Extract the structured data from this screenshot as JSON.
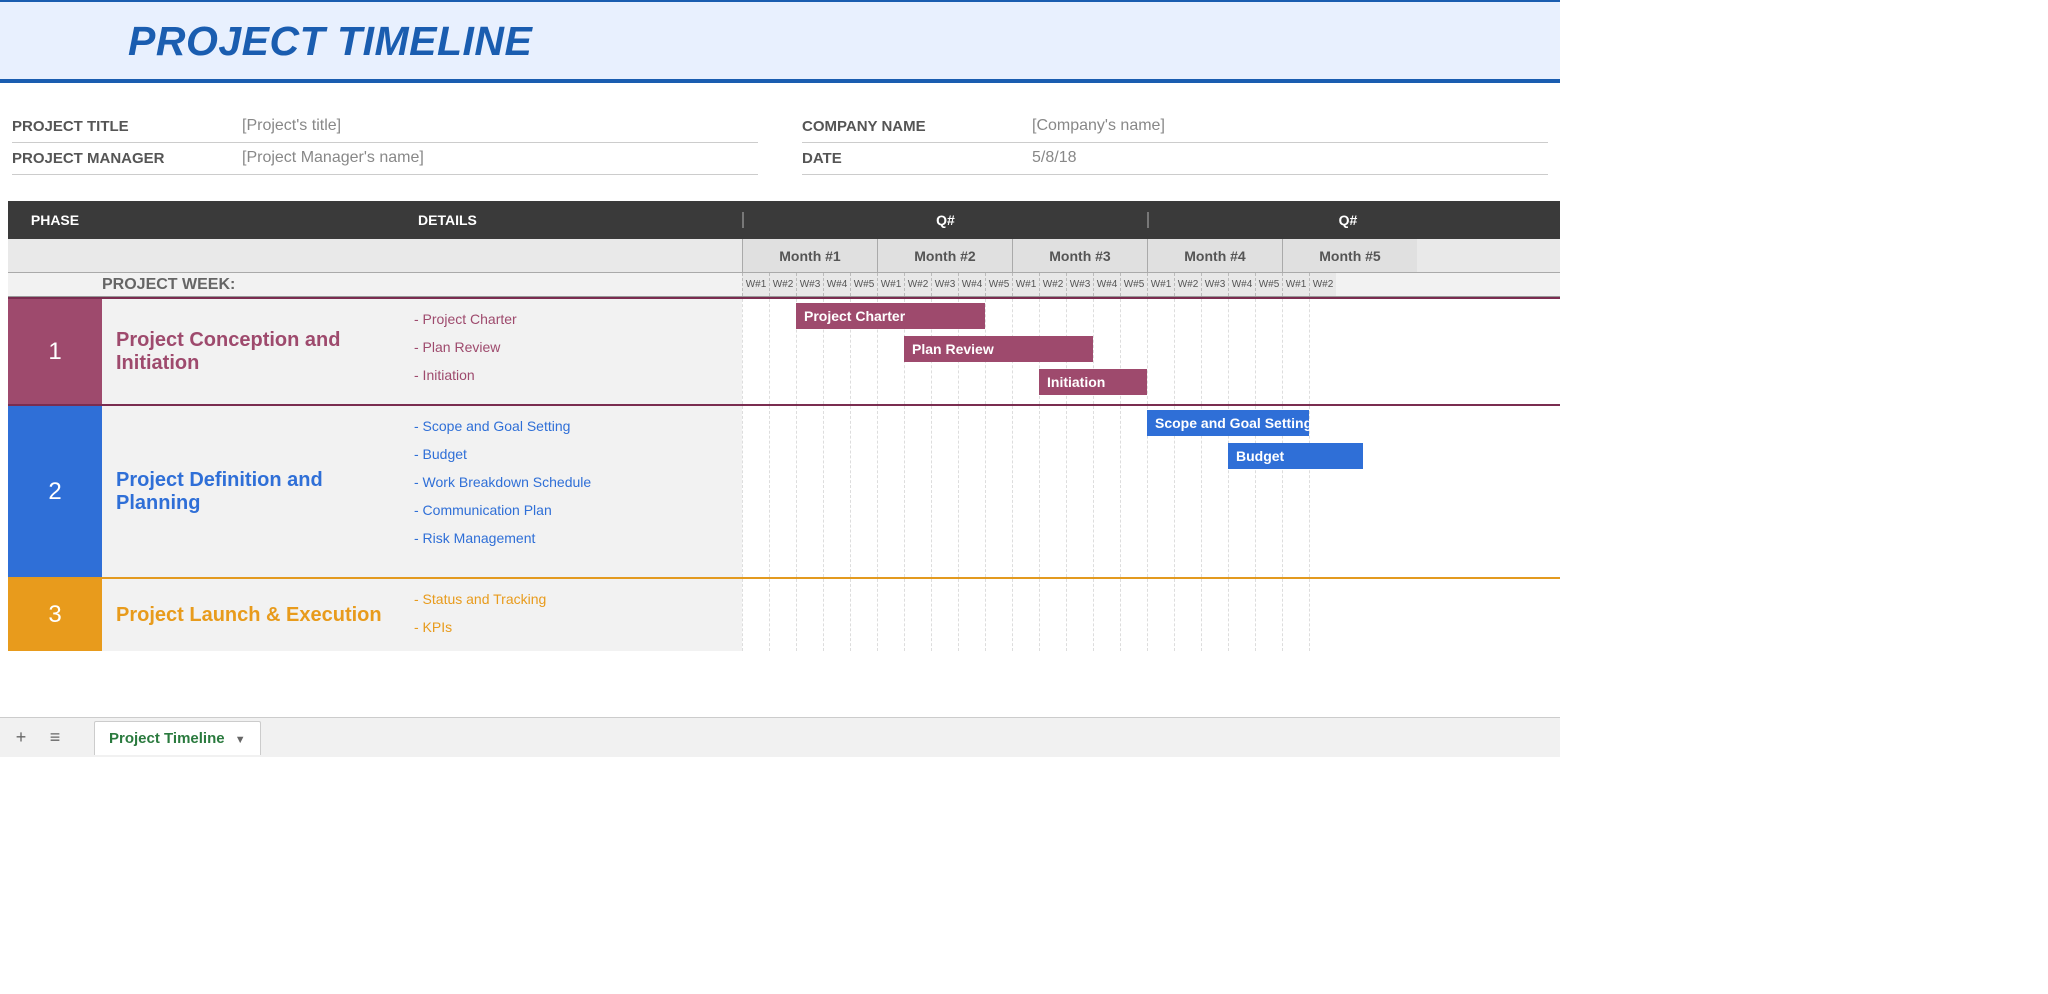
{
  "title": "PROJECT TIMELINE",
  "meta": {
    "left": [
      {
        "label": "PROJECT TITLE",
        "value": "[Project's title]"
      },
      {
        "label": "PROJECT MANAGER",
        "value": "[Project Manager's name]"
      }
    ],
    "right": [
      {
        "label": "COMPANY NAME",
        "value": "[Company's name]"
      },
      {
        "label": "DATE",
        "value": "5/8/18"
      }
    ]
  },
  "headers": {
    "phase": "PHASE",
    "details": "DETAILS",
    "quarters": [
      "Q#",
      "Q#"
    ],
    "months": [
      "Month #1",
      "Month #2",
      "Month #3",
      "Month #4",
      "Month #5"
    ],
    "weeks": [
      "W#1",
      "W#2",
      "W#3",
      "W#4",
      "W#5",
      "W#1",
      "W#2",
      "W#3",
      "W#4",
      "W#5",
      "W#1",
      "W#2",
      "W#3",
      "W#4",
      "W#5",
      "W#1",
      "W#2",
      "W#3",
      "W#4",
      "W#5",
      "W#1",
      "W#2"
    ],
    "project_week": "PROJECT WEEK:"
  },
  "phases": [
    {
      "num": "1",
      "title": "Project Conception and Initiation",
      "details": [
        "- Project Charter",
        "- Plan Review",
        "- Initiation"
      ],
      "bars": [
        {
          "label": "Project Charter",
          "start": 2,
          "span": 7,
          "row": 0
        },
        {
          "label": "Plan Review",
          "start": 6,
          "span": 7,
          "row": 1
        },
        {
          "label": "Initiation",
          "start": 11,
          "span": 4,
          "row": 2
        }
      ]
    },
    {
      "num": "2",
      "title": "Project Definition and Planning",
      "details": [
        "- Scope and Goal Setting",
        "- Budget",
        "- Work Breakdown Schedule",
        "- Communication Plan",
        "- Risk Management"
      ],
      "bars": [
        {
          "label": "Scope and Goal Setting",
          "start": 15,
          "span": 6,
          "row": 0
        },
        {
          "label": "Budget",
          "start": 18,
          "span": 5,
          "row": 1
        }
      ]
    },
    {
      "num": "3",
      "title": "Project Launch & Execution",
      "details": [
        "- Status and Tracking",
        "- KPIs"
      ],
      "bars": []
    }
  ],
  "tabs": {
    "name": "Project Timeline"
  },
  "colors": {
    "p1": "#9e4a6d",
    "p2": "#2f6fd7",
    "p3": "#e89b1c"
  }
}
